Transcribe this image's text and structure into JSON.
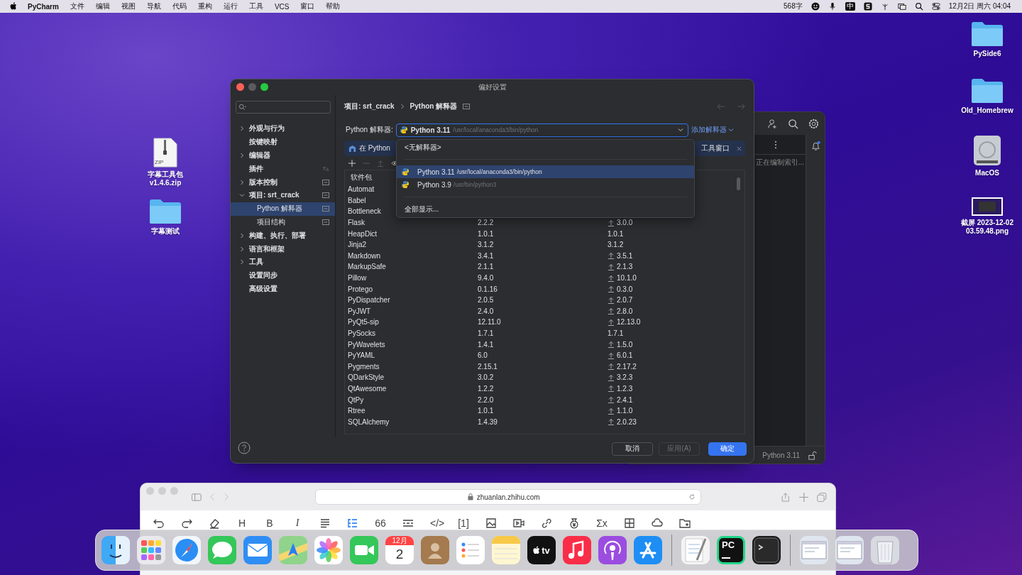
{
  "menu_bar": {
    "app": "PyCharm",
    "menus": [
      "文件",
      "编辑",
      "视图",
      "导航",
      "代码",
      "重构",
      "运行",
      "工具",
      "VCS",
      "窗口",
      "帮助"
    ],
    "word_count": "568字",
    "input_method": "中",
    "clock": "12月2日 周六 04:04"
  },
  "desktop_left": [
    {
      "kind": "zip",
      "badge": "ZIP",
      "label": "字幕工具包 v1.4.6.zip"
    },
    {
      "kind": "folder",
      "label": "字幕测试"
    }
  ],
  "desktop_right": [
    {
      "kind": "folder",
      "label": "PySide6"
    },
    {
      "kind": "folder",
      "label": "Old_Homebrew"
    },
    {
      "kind": "disk",
      "label": "MacOS"
    },
    {
      "kind": "screenshot",
      "label": "截屏 2023-12-02 03.59.48.png"
    }
  ],
  "ide_window": {
    "indexing": "正在编制索引...",
    "interpreter": "Python 3.11"
  },
  "dialog": {
    "title": "偏好设置",
    "sidebar": [
      {
        "label": "外观与行为",
        "kind": "plain",
        "expanded": false,
        "selected": false
      },
      {
        "label": "按键映射",
        "kind": "plain",
        "selected": false
      },
      {
        "label": "编辑器",
        "kind": "plain",
        "expanded": false,
        "selected": false
      },
      {
        "label": "插件",
        "kind": "lang",
        "selected": false
      },
      {
        "label": "版本控制",
        "kind": "project",
        "expanded": false,
        "selected": false
      },
      {
        "label": "项目: srt_crack",
        "kind": "project",
        "expanded": true,
        "selected": false,
        "children": [
          {
            "label": "Python 解释器",
            "kind": "project",
            "selected": true
          },
          {
            "label": "项目结构",
            "kind": "project",
            "selected": false
          }
        ]
      },
      {
        "label": "构建、执行、部署",
        "kind": "plain",
        "expanded": false,
        "selected": false
      },
      {
        "label": "语言和框架",
        "kind": "plain",
        "expanded": false,
        "selected": false
      },
      {
        "label": "工具",
        "kind": "plain",
        "expanded": false,
        "selected": false
      },
      {
        "label": "设置同步",
        "kind": "plain",
        "selected": false
      },
      {
        "label": "高级设置",
        "kind": "plain",
        "selected": false
      }
    ],
    "breadcrumb": [
      "项目: srt_crack",
      "Python 解释器"
    ],
    "interpreter_label": "Python 解释器:",
    "interpreter": {
      "name": "Python 3.11",
      "path": "/usr/local/anaconda3/bin/python"
    },
    "add_interpreter": "添加解释器",
    "banner": {
      "start": "在 Python",
      "end": "工具窗口"
    },
    "dropdown": {
      "none_option": "<无解释器>",
      "options": [
        {
          "name": "Python 3.11",
          "path": "/usr/local/anaconda3/bin/python",
          "selected": true
        },
        {
          "name": "Python 3.9",
          "path": "/usr/bin/python3",
          "selected": false
        }
      ],
      "show_all": "全部显示..."
    },
    "table": {
      "columns": [
        "软件包"
      ],
      "rows": [
        {
          "name": "Automat"
        },
        {
          "name": "Babel"
        },
        {
          "name": "Bottleneck"
        },
        {
          "name": "Flask",
          "version": "2.2.2",
          "latest": "3.0.0",
          "upgrade": true
        },
        {
          "name": "HeapDict",
          "version": "1.0.1",
          "latest": "1.0.1",
          "upgrade": false
        },
        {
          "name": "Jinja2",
          "version": "3.1.2",
          "latest": "3.1.2",
          "upgrade": false
        },
        {
          "name": "Markdown",
          "version": "3.4.1",
          "latest": "3.5.1",
          "upgrade": true
        },
        {
          "name": "MarkupSafe",
          "version": "2.1.1",
          "latest": "2.1.3",
          "upgrade": true
        },
        {
          "name": "Pillow",
          "version": "9.4.0",
          "latest": "10.1.0",
          "upgrade": true
        },
        {
          "name": "Protego",
          "version": "0.1.16",
          "latest": "0.3.0",
          "upgrade": true
        },
        {
          "name": "PyDispatcher",
          "version": "2.0.5",
          "latest": "2.0.7",
          "upgrade": true
        },
        {
          "name": "PyJWT",
          "version": "2.4.0",
          "latest": "2.8.0",
          "upgrade": true
        },
        {
          "name": "PyQt5-sip",
          "version": "12.11.0",
          "latest": "12.13.0",
          "upgrade": true
        },
        {
          "name": "PySocks",
          "version": "1.7.1",
          "latest": "1.7.1",
          "upgrade": false
        },
        {
          "name": "PyWavelets",
          "version": "1.4.1",
          "latest": "1.5.0",
          "upgrade": true
        },
        {
          "name": "PyYAML",
          "version": "6.0",
          "latest": "6.0.1",
          "upgrade": true
        },
        {
          "name": "Pygments",
          "version": "2.15.1",
          "latest": "2.17.2",
          "upgrade": true
        },
        {
          "name": "QDarkStyle",
          "version": "3.0.2",
          "latest": "3.2.3",
          "upgrade": true
        },
        {
          "name": "QtAwesome",
          "version": "1.2.2",
          "latest": "1.2.3",
          "upgrade": true
        },
        {
          "name": "QtPy",
          "version": "2.2.0",
          "latest": "2.4.1",
          "upgrade": true
        },
        {
          "name": "Rtree",
          "version": "1.0.1",
          "latest": "1.1.0",
          "upgrade": true
        },
        {
          "name": "SQLAlchemy",
          "version": "1.4.39",
          "latest": "2.0.23",
          "upgrade": true
        }
      ]
    },
    "buttons": [
      {
        "label": "取消",
        "kind": "normal",
        "disabled": false
      },
      {
        "label": "应用(A)",
        "kind": "normal",
        "disabled": true
      },
      {
        "label": "确定",
        "kind": "primary",
        "disabled": false
      }
    ]
  },
  "browser": {
    "url": "zhuanlan.zhihu.com",
    "toolbar": [
      {
        "kind": "undo",
        "active": false
      },
      {
        "kind": "redo",
        "active": false
      },
      {
        "kind": "eraser",
        "active": false
      },
      {
        "kind": "text",
        "label": "H",
        "active": false
      },
      {
        "kind": "text",
        "label": "B",
        "active": false
      },
      {
        "kind": "italic",
        "label": "I",
        "active": false
      },
      {
        "kind": "align",
        "active": false
      },
      {
        "kind": "list",
        "active": true
      },
      {
        "kind": "text",
        "label": "66",
        "active": false
      },
      {
        "kind": "rule",
        "active": false
      },
      {
        "kind": "text",
        "label": "</>",
        "active": false
      },
      {
        "kind": "text",
        "label": "[1]",
        "active": false
      },
      {
        "kind": "image",
        "active": false
      },
      {
        "kind": "video",
        "active": false
      },
      {
        "kind": "link",
        "active": false
      },
      {
        "kind": "money",
        "active": false
      },
      {
        "kind": "text",
        "label": "Σx",
        "active": false
      },
      {
        "kind": "table",
        "active": false
      },
      {
        "kind": "cloud",
        "active": false
      },
      {
        "kind": "folder",
        "active": false
      }
    ]
  },
  "dock": [
    {
      "kind": "finder"
    },
    {
      "kind": "launchpad"
    },
    {
      "kind": "safari"
    },
    {
      "kind": "messages"
    },
    {
      "kind": "mail"
    },
    {
      "kind": "maps"
    },
    {
      "kind": "photos"
    },
    {
      "kind": "facetime"
    },
    {
      "kind": "calendar",
      "month": "12月",
      "day": "2"
    },
    {
      "kind": "contacts"
    },
    {
      "kind": "reminders"
    },
    {
      "kind": "notes"
    },
    {
      "kind": "tv",
      "label": "tv"
    },
    {
      "kind": "music"
    },
    {
      "kind": "podcasts"
    },
    {
      "kind": "appstore"
    },
    {
      "kind": "separator"
    },
    {
      "kind": "textedit"
    },
    {
      "kind": "pycharm",
      "label": "PC"
    },
    {
      "kind": "terminal"
    },
    {
      "kind": "separator"
    },
    {
      "kind": "window"
    },
    {
      "kind": "window"
    },
    {
      "kind": "trash"
    }
  ]
}
